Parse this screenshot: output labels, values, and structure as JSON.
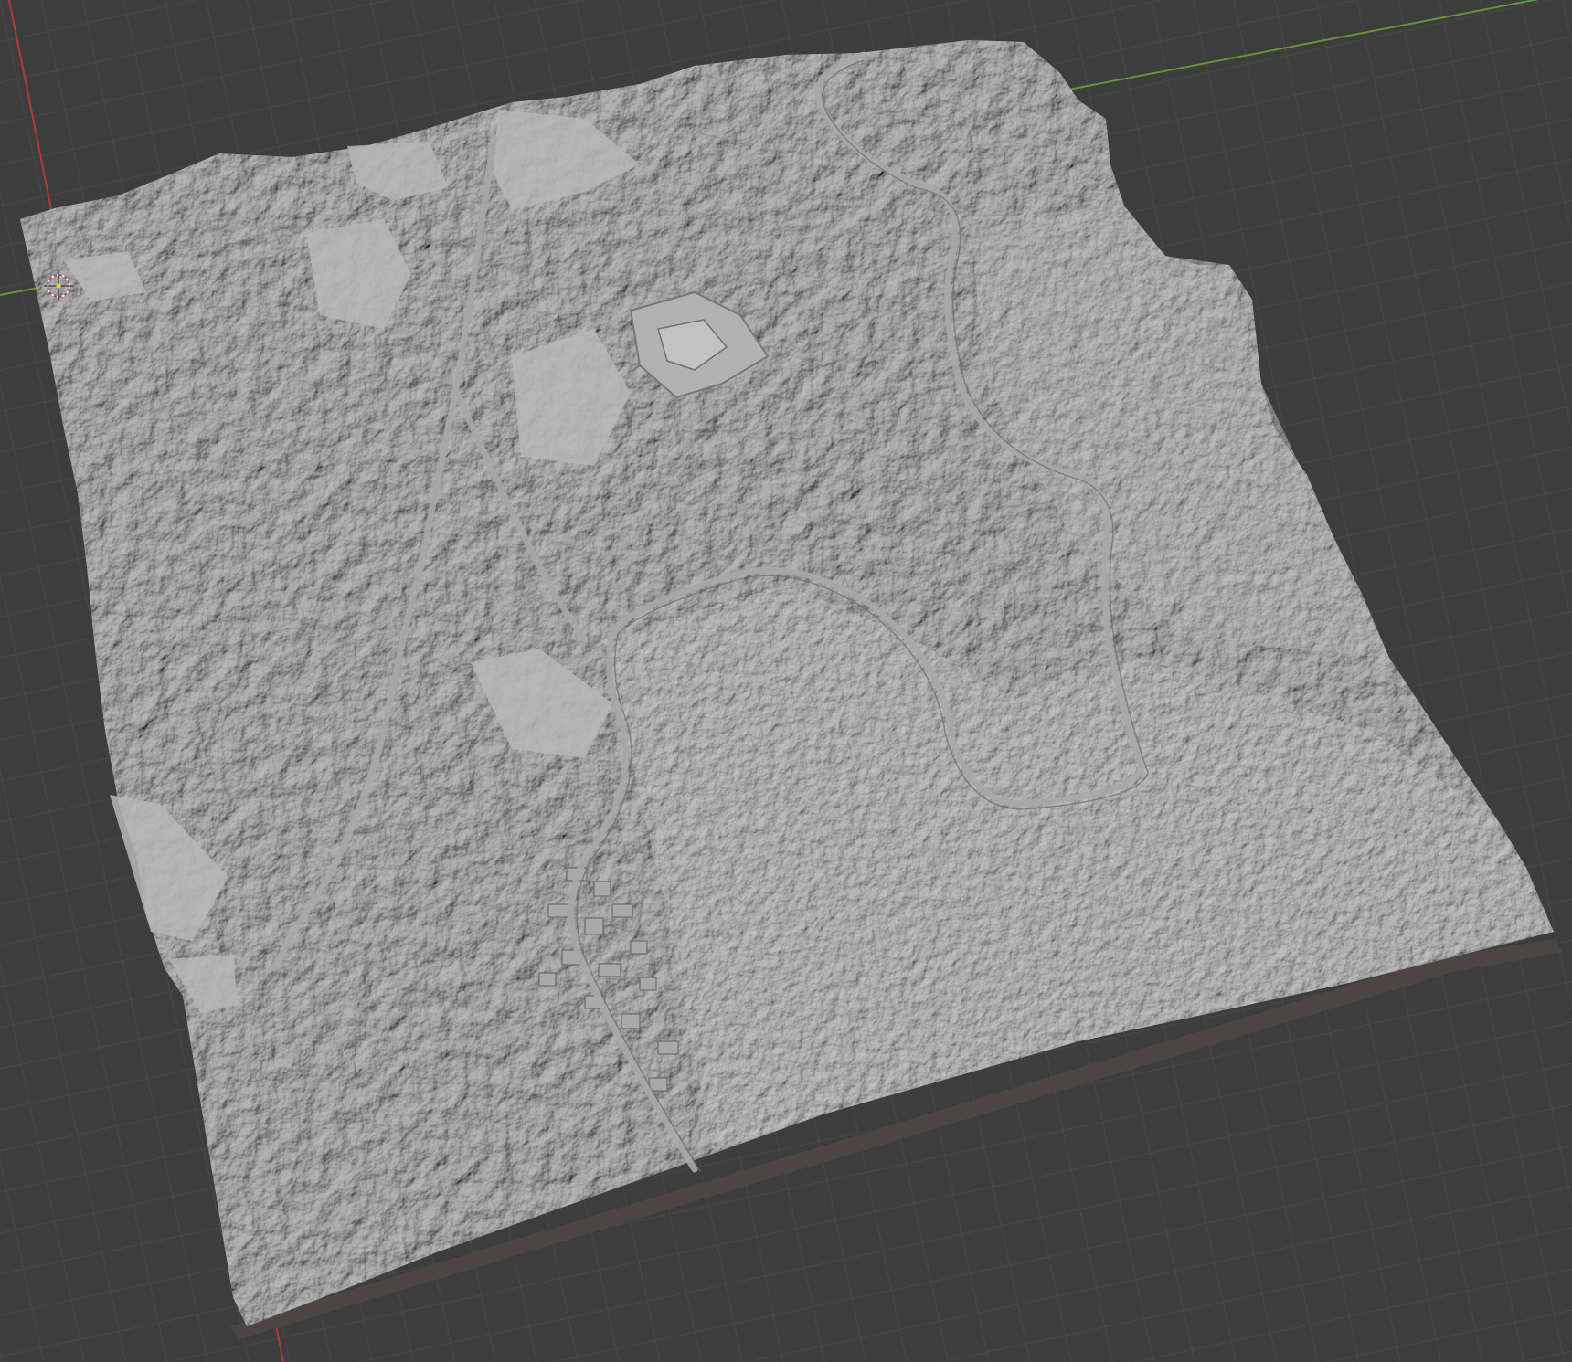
{
  "viewport": {
    "background": "#3d3d3d",
    "grid_color": "#4a4a4a",
    "axis_x_color": "#c33a3a",
    "axis_y_color": "#6fa23a"
  },
  "scene": {
    "object": "terrain-mesh",
    "shading": "solid-gray",
    "mesh_color": "#8c8c8c",
    "road_color": "#a8a8a8",
    "clearing_color": "#b8b8b8",
    "base_color": "#4b4643",
    "icon": "object-origin-icon"
  }
}
